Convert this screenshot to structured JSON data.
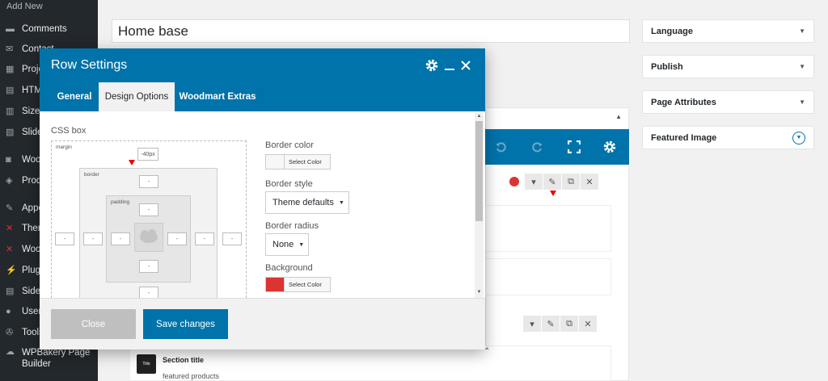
{
  "sidebar": {
    "add_new": "Add New",
    "items": [
      {
        "label": "Comments",
        "icon": "comments-icon"
      },
      {
        "label": "Contact",
        "icon": "mail-icon"
      },
      {
        "label": "Projects",
        "icon": "portfolio-icon"
      },
      {
        "label": "HTML Blocks",
        "icon": "html-icon"
      },
      {
        "label": "Size Guides",
        "icon": "table-icon"
      },
      {
        "label": "Slides",
        "icon": "slides-icon"
      },
      {
        "label": "WooCommerce",
        "icon": "woo-icon"
      },
      {
        "label": "Products",
        "icon": "products-icon"
      },
      {
        "label": "Appearance",
        "icon": "brush-icon"
      },
      {
        "label": "Theme Settings",
        "icon": "x-icon"
      },
      {
        "label": "Woodmart",
        "icon": "x-icon"
      },
      {
        "label": "Plugins",
        "icon": "plugin-icon"
      },
      {
        "label": "Sidebars",
        "icon": "sidebar-icon"
      },
      {
        "label": "Users",
        "icon": "user-icon"
      },
      {
        "label": "Tools",
        "icon": "wrench-icon"
      },
      {
        "label": "WPBakery Page Builder",
        "icon": "wpbakery-icon"
      }
    ]
  },
  "page": {
    "title_value": "Home base"
  },
  "meta_boxes": [
    {
      "label": "Language"
    },
    {
      "label": "Publish"
    },
    {
      "label": "Page Attributes"
    },
    {
      "label": "Featured Image"
    }
  ],
  "modal": {
    "title": "Row Settings",
    "tabs": [
      "General",
      "Design Options",
      "Woodmart Extras"
    ],
    "css_box_label": "CSS box",
    "box_labels": {
      "margin": "margin",
      "border": "border",
      "padding": "padding"
    },
    "margin_top_value": "-40px",
    "empty_value": "-",
    "fields": {
      "border_color_label": "Border color",
      "border_style_label": "Border style",
      "border_style_value": "Theme defaults",
      "border_radius_label": "Border radius",
      "border_radius_value": "None",
      "background_label": "Background",
      "select_color_label": "Select Color",
      "background_color": "#dd3333"
    },
    "buttons": {
      "close": "Close",
      "save": "Save changes"
    }
  },
  "builder": {
    "section_icon_text": "Title",
    "section_title": "Section title",
    "section_subtitle": "featured products"
  },
  "colors": {
    "accent": "#0073aa",
    "sidebar": "#23282d",
    "red": "#dd3333"
  }
}
